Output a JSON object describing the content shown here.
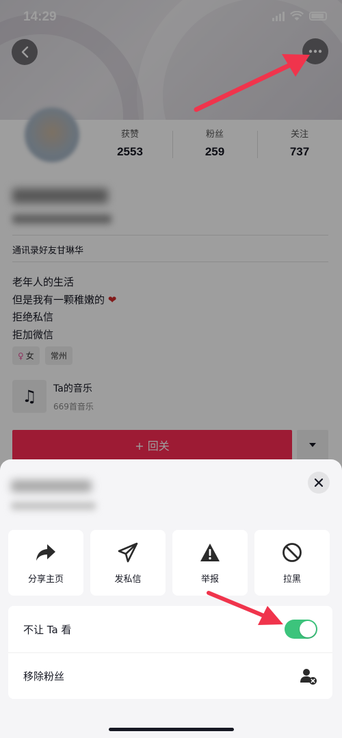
{
  "status_bar": {
    "time": "14:29"
  },
  "profile": {
    "stats": [
      {
        "label": "获赞",
        "value": "2553"
      },
      {
        "label": "粉丝",
        "value": "259"
      },
      {
        "label": "关注",
        "value": "737"
      }
    ],
    "contact_line": "通讯录好友甘琳华",
    "bio": [
      "老年人的生活",
      "但是我有一颗稚嫩的",
      "拒绝私信",
      "拒加微信"
    ],
    "tags": {
      "gender": "女",
      "city": "常州"
    },
    "music": {
      "title": "Ta的音乐",
      "count": "669首音乐"
    },
    "follow_label": "+ 回关"
  },
  "sheet": {
    "actions": [
      {
        "label": "分享主页",
        "icon": "share-icon"
      },
      {
        "label": "发私信",
        "icon": "send-message-icon"
      },
      {
        "label": "举报",
        "icon": "report-warning-icon"
      },
      {
        "label": "拉黑",
        "icon": "block-icon"
      }
    ],
    "settings": [
      {
        "label": "不让 Ta 看",
        "toggle_on": true
      },
      {
        "label": "移除粉丝",
        "icon": "remove-follower-icon"
      }
    ]
  },
  "colors": {
    "accent": "#fe2c55",
    "toggle_on": "#3cc47c",
    "annotation_arrow": "#f0344c"
  }
}
